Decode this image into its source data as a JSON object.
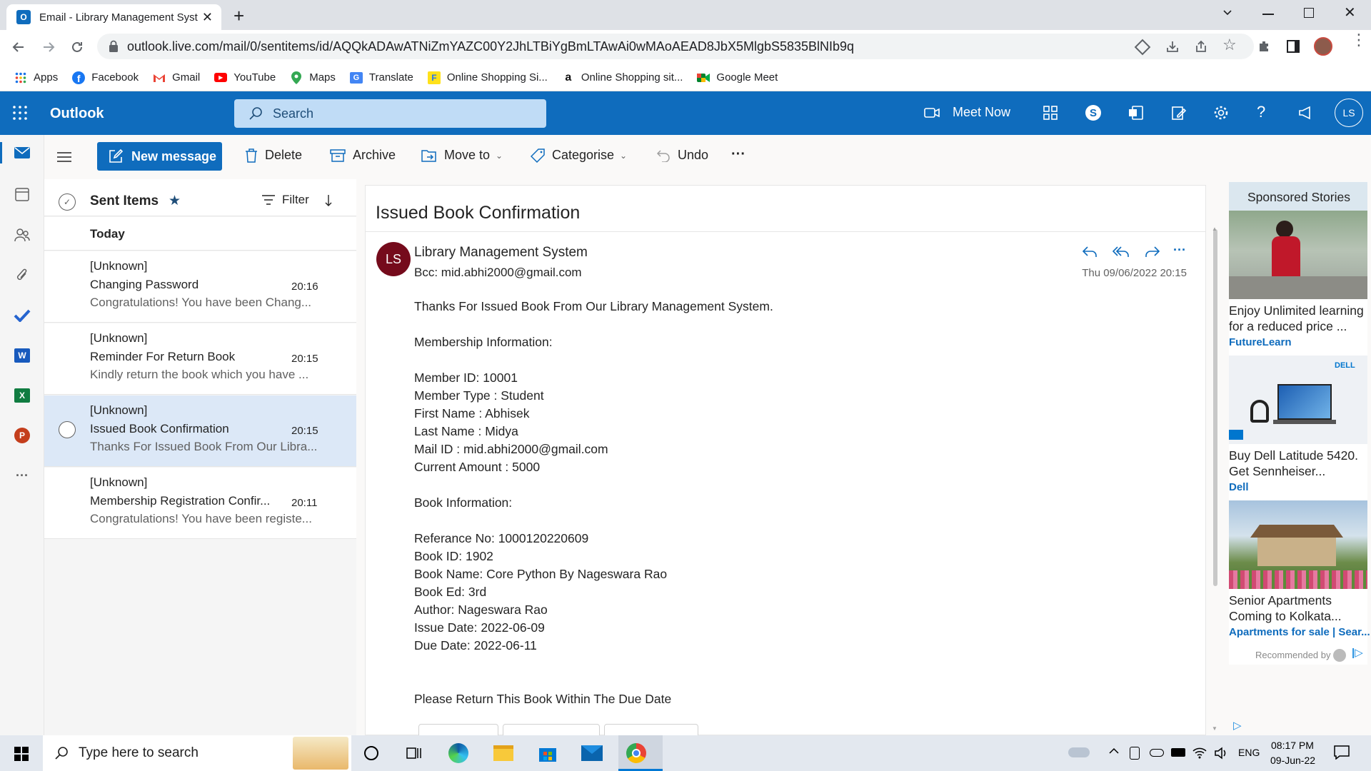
{
  "browser": {
    "tab_title": "Email - Library Management Syst",
    "url": "outlook.live.com/mail/0/sentitems/id/AQQkADAwATNiZmYAZC00Y2JhLTBiYgBmLTAwAi0wMAoAEAD8JbX5MlgbS5835BlNIb9q",
    "bookmarks": [
      {
        "label": "Apps",
        "icon": "apps-grid-icon"
      },
      {
        "label": "Facebook",
        "icon": "facebook-icon"
      },
      {
        "label": "Gmail",
        "icon": "gmail-icon"
      },
      {
        "label": "YouTube",
        "icon": "youtube-icon"
      },
      {
        "label": "Maps",
        "icon": "maps-pin-icon"
      },
      {
        "label": "Translate",
        "icon": "translate-icon"
      },
      {
        "label": "Online Shopping Si...",
        "icon": "flipkart-icon"
      },
      {
        "label": "Online Shopping sit...",
        "icon": "amazon-icon"
      },
      {
        "label": "Google Meet",
        "icon": "google-meet-icon"
      }
    ]
  },
  "outlook": {
    "app_name": "Outlook",
    "search_placeholder": "Search",
    "meet_now": "Meet Now",
    "user_initials": "LS",
    "brand_color": "#0f6cbd"
  },
  "commands": {
    "new_message": "New message",
    "delete": "Delete",
    "archive": "Archive",
    "move_to": "Move to",
    "categorise": "Categorise",
    "undo": "Undo"
  },
  "folder": {
    "name": "Sent Items",
    "filter": "Filter",
    "group": "Today"
  },
  "messages": [
    {
      "from": "[Unknown]",
      "subject": "Changing Password",
      "time": "20:16",
      "preview": "Congratulations! You have been Chang..."
    },
    {
      "from": "[Unknown]",
      "subject": "Reminder For Return Book",
      "time": "20:15",
      "preview": "Kindly return the book which you have ..."
    },
    {
      "from": "[Unknown]",
      "subject": "Issued Book Confirmation",
      "time": "20:15",
      "preview": "Thanks For Issued Book From Our Libra..."
    },
    {
      "from": "[Unknown]",
      "subject": "Membership Registration Confir...",
      "time": "20:11",
      "preview": "Congratulations! You have been registe..."
    }
  ],
  "email": {
    "subject": "Issued Book Confirmation",
    "avatar": "LS",
    "sender": "Library Management System",
    "bcc": "Bcc:  mid.abhi2000@gmail.com",
    "date": "Thu 09/06/2022 20:15",
    "body": [
      "Thanks For Issued Book From Our Library Management System.",
      "",
      "Membership Information:",
      "",
      "Member ID: 10001",
      "Member Type : Student",
      "First Name : Abhisek",
      "Last Name : Midya",
      "Mail ID : mid.abhi2000@gmail.com",
      "Current Amount : 5000",
      "",
      "Book Information:",
      "",
      "Referance No: 1000120220609",
      "Book ID: 1902",
      "Book Name: Core Python By Nageswara Rao",
      "Book Ed: 3rd",
      "Author: Nageswara Rao",
      "Issue Date: 2022-06-09",
      "Due Date: 2022-06-11",
      "",
      "",
      "Please Return This Book Within The Due Date"
    ]
  },
  "ads": {
    "heading": "Sponsored Stories",
    "items": [
      {
        "line1": "Enjoy Unlimited learning",
        "line2": "for a reduced price ...",
        "source": "FutureLearn"
      },
      {
        "line1": "Buy Dell Latitude 5420.",
        "line2": "Get Sennheiser...",
        "source": "Dell"
      },
      {
        "line1": "Senior Apartments",
        "line2": "Coming to Kolkata...",
        "source": "Apartments for sale | Sear..."
      }
    ],
    "recommended": "Recommended by"
  },
  "taskbar": {
    "search_placeholder": "Type here to search",
    "lang": "ENG",
    "time": "08:17 PM",
    "date": "09-Jun-22"
  }
}
